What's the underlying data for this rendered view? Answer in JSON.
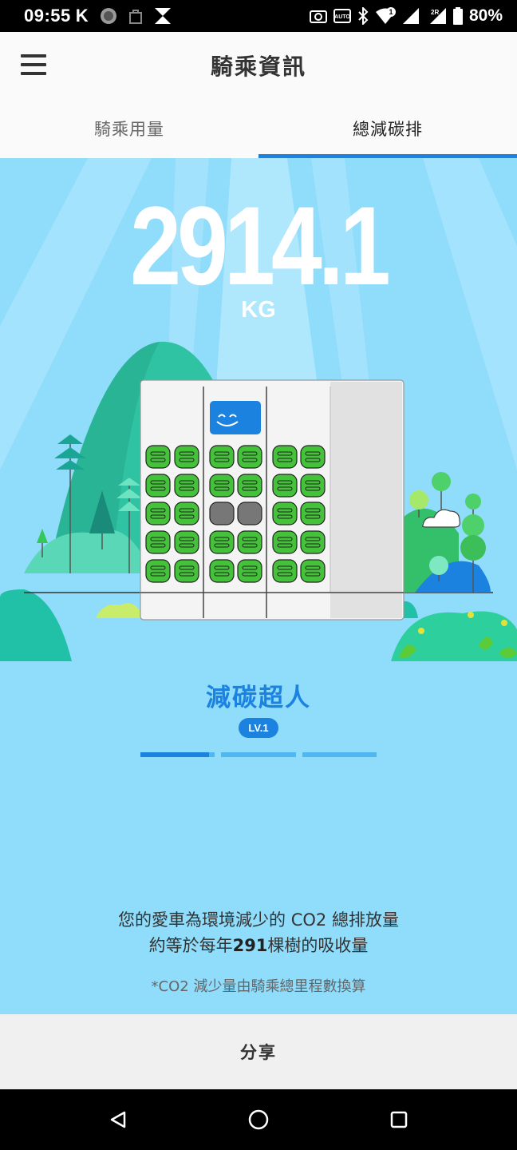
{
  "status_bar": {
    "time": "09:55",
    "k_label": "K",
    "battery_text": "80%",
    "signal_badge_1": "1",
    "signal_badge_2": "2R",
    "auto_label": "AUTO"
  },
  "app_bar": {
    "title": "騎乘資訊"
  },
  "tabs": [
    {
      "label": "騎乘用量",
      "active": false
    },
    {
      "label": "總減碳排",
      "active": true
    }
  ],
  "hero": {
    "total_value": "2914.1",
    "unit": "KG",
    "level_title": "減碳超人",
    "level_badge": "LV.1",
    "progress_segments": [
      0.92,
      0,
      0
    ]
  },
  "description": {
    "line1": "您的愛車為環境減少的 CO2 總排放量",
    "line2_prefix": "約等於每年",
    "trees": "291",
    "line2_suffix": "棵樹的吸收量",
    "note": "*CO2 減少量由騎乘總里程數換算"
  },
  "share_button": "分享",
  "colors": {
    "accent": "#1b82e0",
    "hero_bg": "#8fdcfb",
    "battery_green": "#44c23a"
  }
}
